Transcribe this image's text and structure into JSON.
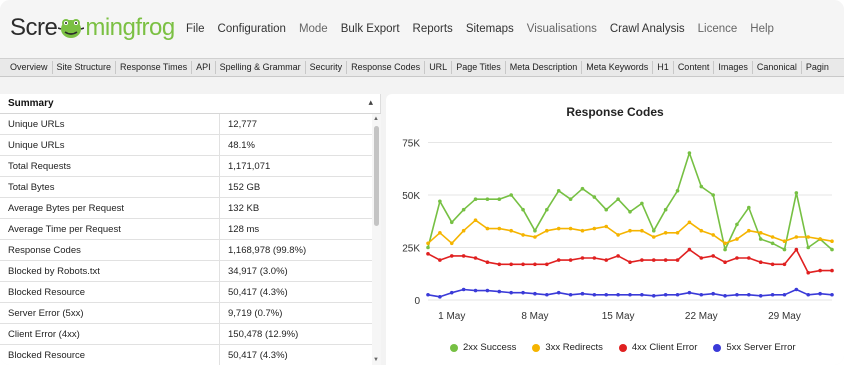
{
  "app": {
    "logo_left": "Scre",
    "logo_right": "mingfrog",
    "logo_icon": "frog-icon"
  },
  "menu": [
    "File",
    "Configuration",
    "Mode",
    "Bulk Export",
    "Reports",
    "Sitemaps",
    "Visualisations",
    "Crawl Analysis",
    "Licence",
    "Help"
  ],
  "tabs": [
    "Overview",
    "Site Structure",
    "Response Times",
    "API",
    "Spelling & Grammar",
    "Security",
    "Response Codes",
    "URL",
    "Page Titles",
    "Meta Description",
    "Meta Keywords",
    "H1",
    "Content",
    "Images",
    "Canonical",
    "Pagin"
  ],
  "summary": {
    "title": "Summary",
    "rows": [
      {
        "label": "Unique URLs",
        "value": "12,777"
      },
      {
        "label": "Unique URLs",
        "value": "48.1%"
      },
      {
        "label": "Total Requests",
        "value": "1,171,071"
      },
      {
        "label": "Total Bytes",
        "value": "152 GB"
      },
      {
        "label": "Average Bytes per Request",
        "value": "132 KB"
      },
      {
        "label": "Average Time per Request",
        "value": "128 ms"
      },
      {
        "label": "Response Codes",
        "value": "1,168,978 (99.8%)"
      },
      {
        "label": "Blocked by Robots.txt",
        "value": "34,917 (3.0%)"
      },
      {
        "label": "Blocked Resource",
        "value": "50,417 (4.3%)"
      },
      {
        "label": "Server Error (5xx)",
        "value": "9,719 (0.7%)"
      },
      {
        "label": "Client Error (4xx)",
        "value": "150,478 (12.9%)"
      },
      {
        "label": "Blocked Resource",
        "value": "50,417 (4.3%)"
      }
    ]
  },
  "colors": {
    "green": "#76c043",
    "orange": "#f5b400",
    "red": "#e02020",
    "blue": "#3a3ad8"
  },
  "chart_data": {
    "type": "line",
    "title": "Response Codes",
    "ylim": [
      0,
      80000
    ],
    "yticks": [
      0,
      25000,
      50000,
      75000
    ],
    "ytick_labels": [
      "0",
      "25K",
      "50K",
      "75K"
    ],
    "xticks": [
      2,
      9,
      16,
      23,
      30
    ],
    "xtick_labels": [
      "1 May",
      "8 May",
      "15 May",
      "22 May",
      "29 May"
    ],
    "xlim": [
      0,
      34
    ],
    "grid": "horizontal",
    "legend_position": "bottom",
    "series": [
      {
        "name": "2xx Success",
        "color": "#76c043",
        "x": [
          0,
          1,
          2,
          3,
          4,
          5,
          6,
          7,
          8,
          9,
          10,
          11,
          12,
          13,
          14,
          15,
          16,
          17,
          18,
          19,
          20,
          21,
          22,
          23,
          24,
          25,
          26,
          27,
          28,
          29,
          30,
          31,
          32,
          33,
          34
        ],
        "values": [
          25000,
          47000,
          37000,
          43000,
          48000,
          48000,
          48000,
          50000,
          43000,
          33000,
          43000,
          52000,
          48000,
          53000,
          49000,
          43000,
          48000,
          42000,
          46000,
          33000,
          43000,
          52000,
          70000,
          54000,
          50000,
          24000,
          36000,
          44000,
          29000,
          27000,
          24000,
          51000,
          25000,
          29000,
          24000
        ]
      },
      {
        "name": "3xx Redirects",
        "color": "#f5b400",
        "x": [
          0,
          1,
          2,
          3,
          4,
          5,
          6,
          7,
          8,
          9,
          10,
          11,
          12,
          13,
          14,
          15,
          16,
          17,
          18,
          19,
          20,
          21,
          22,
          23,
          24,
          25,
          26,
          27,
          28,
          29,
          30,
          31,
          32,
          33,
          34
        ],
        "values": [
          27000,
          32000,
          27000,
          33000,
          38000,
          34000,
          34000,
          33000,
          31000,
          30000,
          33000,
          34000,
          34000,
          33000,
          34000,
          35000,
          31000,
          33000,
          33000,
          30000,
          32000,
          32000,
          37000,
          33000,
          31000,
          27000,
          29000,
          33000,
          32000,
          30000,
          28000,
          30000,
          30000,
          29000,
          28000
        ]
      },
      {
        "name": "4xx Client Error",
        "color": "#e02020",
        "x": [
          0,
          1,
          2,
          3,
          4,
          5,
          6,
          7,
          8,
          9,
          10,
          11,
          12,
          13,
          14,
          15,
          16,
          17,
          18,
          19,
          20,
          21,
          22,
          23,
          24,
          25,
          26,
          27,
          28,
          29,
          30,
          31,
          32,
          33,
          34
        ],
        "values": [
          22000,
          19000,
          21000,
          21000,
          20000,
          18000,
          17000,
          17000,
          17000,
          17000,
          17000,
          19000,
          19000,
          20000,
          20000,
          19000,
          21000,
          18000,
          19000,
          19000,
          19000,
          19000,
          24000,
          20000,
          21000,
          18000,
          20000,
          20000,
          18000,
          17000,
          17000,
          24000,
          13000,
          14000,
          14000
        ]
      },
      {
        "name": "5xx Server Error",
        "color": "#3a3ad8",
        "x": [
          0,
          1,
          2,
          3,
          4,
          5,
          6,
          7,
          8,
          9,
          10,
          11,
          12,
          13,
          14,
          15,
          16,
          17,
          18,
          19,
          20,
          21,
          22,
          23,
          24,
          25,
          26,
          27,
          28,
          29,
          30,
          31,
          32,
          33,
          34
        ],
        "values": [
          2500,
          1500,
          3500,
          5000,
          4500,
          4500,
          4000,
          3500,
          3500,
          3000,
          2500,
          3500,
          2500,
          3000,
          2500,
          2500,
          2500,
          2500,
          2500,
          2000,
          2500,
          2500,
          3500,
          2500,
          3000,
          2000,
          2500,
          2500,
          2000,
          2500,
          2500,
          5000,
          2500,
          3000,
          2500
        ]
      }
    ]
  }
}
